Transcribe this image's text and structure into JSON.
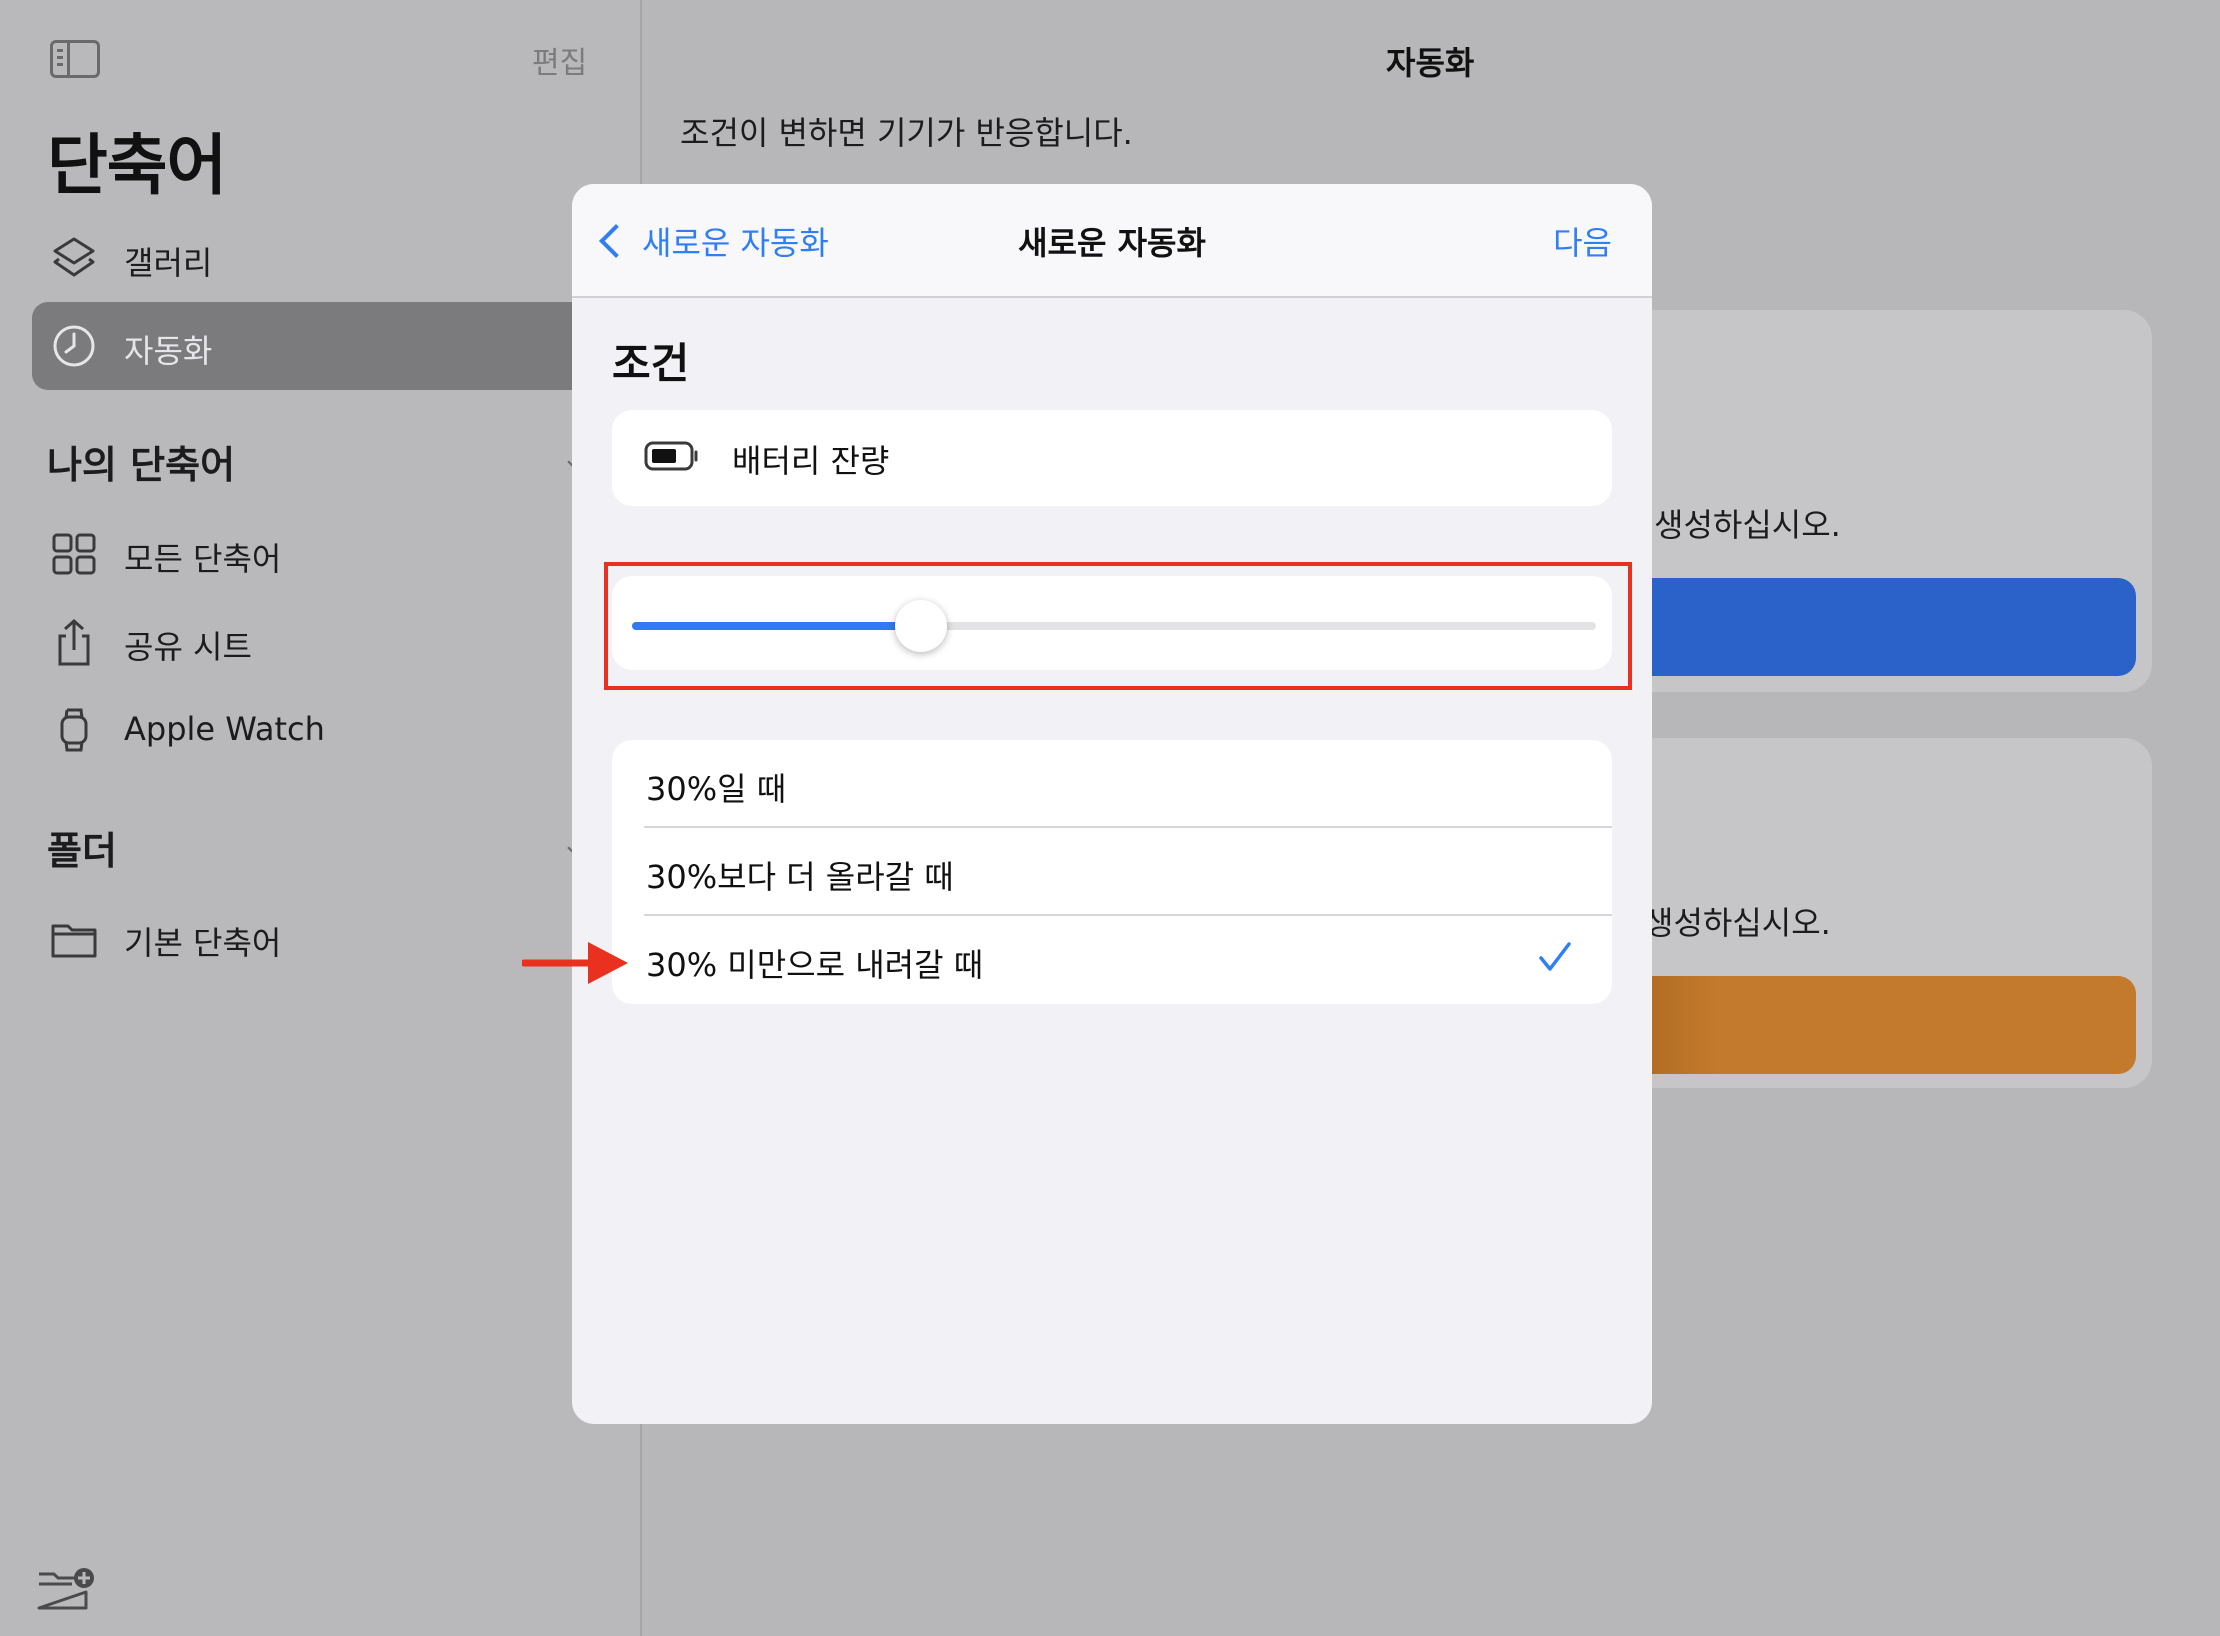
{
  "sidebar": {
    "edit_label": "편집",
    "app_title": "단축어",
    "nav": [
      {
        "label": "갤러리",
        "icon": "layers-icon"
      },
      {
        "label": "자동화",
        "icon": "clock-icon",
        "active": true
      }
    ],
    "my_shortcuts_title": "나의 단축어",
    "my_shortcuts": [
      {
        "label": "모든 단축어",
        "icon": "grid-icon"
      },
      {
        "label": "공유 시트",
        "icon": "share-icon"
      },
      {
        "label": "Apple Watch",
        "icon": "watch-icon"
      }
    ],
    "folders_title": "폴더",
    "folders": [
      {
        "label": "기본 단축어",
        "icon": "folder-icon"
      }
    ]
  },
  "main": {
    "title": "자동화",
    "subtitle": "조건이 변하면 기기가 반응합니다.",
    "card1_text": "생성하십시오.",
    "card2_text": "생성하십시오.",
    "card1_color": "#2a62c9",
    "card2_color": "#c47a2c"
  },
  "modal": {
    "back_label": "새로운 자동화",
    "title": "새로운 자동화",
    "next_label": "다음",
    "section_title": "조건",
    "trigger_label": "배터리 잔량",
    "slider_value_percent": 30,
    "options": [
      {
        "label": "30%일 때",
        "selected": false
      },
      {
        "label": "30%보다 더 올라갈 때",
        "selected": false
      },
      {
        "label": "30% 미만으로 내려갈 때",
        "selected": true
      }
    ],
    "accent_color": "#2f7ef5"
  },
  "annotation_color": "#e8321f"
}
